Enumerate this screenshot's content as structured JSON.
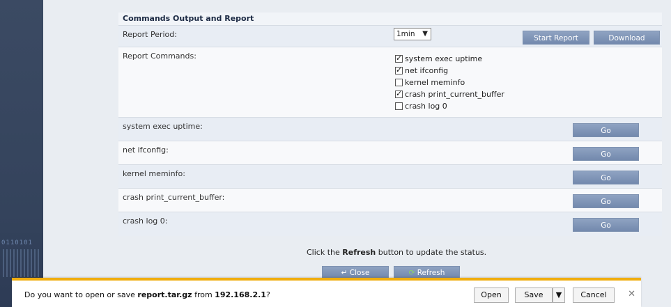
{
  "left_decoration": {
    "binary": "0110101"
  },
  "section": {
    "title": "Commands Output and Report"
  },
  "report_period": {
    "label": "Report Period:",
    "selected": "1min"
  },
  "buttons": {
    "start_report": "Start Report",
    "download": "Download",
    "go": "Go"
  },
  "report_commands": {
    "label": "Report Commands:",
    "options": [
      {
        "label": "system exec uptime",
        "checked": true
      },
      {
        "label": "net ifconfig",
        "checked": true
      },
      {
        "label": "kernel meminfo",
        "checked": false
      },
      {
        "label": "crash print_current_buffer",
        "checked": true
      },
      {
        "label": "crash log 0",
        "checked": false
      }
    ]
  },
  "command_rows": [
    {
      "label": "system exec uptime:"
    },
    {
      "label": "net ifconfig:"
    },
    {
      "label": "kernel meminfo:"
    },
    {
      "label": "crash print_current_buffer:"
    },
    {
      "label": "crash log 0:"
    }
  ],
  "status": {
    "prefix": "Click the ",
    "bold": "Refresh",
    "suffix": " button to update the status."
  },
  "footer": {
    "close": "Close",
    "refresh": "Refresh"
  },
  "download_bar": {
    "prefix": "Do you want to open or save ",
    "filename": "report.tar.gz",
    "middle": " from ",
    "host": "192.168.2.1",
    "suffix": "?",
    "open": "Open",
    "save": "Save",
    "cancel": "Cancel"
  },
  "colors": {
    "accent_bar": "#f0ad0e",
    "button": "#7f94b6",
    "sidebar": "#3b4a63"
  }
}
